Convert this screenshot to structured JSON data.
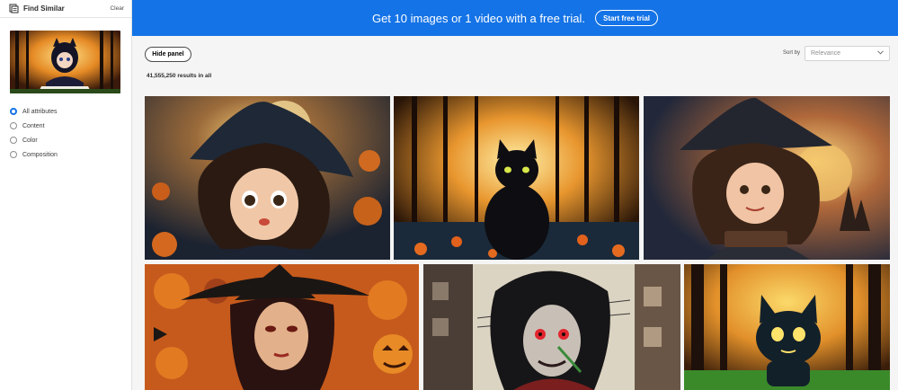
{
  "sidebar": {
    "title": "Find Similar",
    "clear_label": "Clear",
    "options": [
      {
        "label": "All attributes",
        "selected": true
      },
      {
        "label": "Content",
        "selected": false
      },
      {
        "label": "Color",
        "selected": false
      },
      {
        "label": "Composition",
        "selected": false
      }
    ]
  },
  "banner": {
    "text": "Get 10 images or 1 video with a free trial.",
    "cta_label": "Start free trial"
  },
  "toolbar": {
    "hide_panel_label": "Hide panel",
    "results_text": "41,555,250 results in all",
    "sort_label": "Sort by",
    "sort_value": "Relevance"
  },
  "colors": {
    "accent": "#1473e6",
    "sidebar_bg": "#ffffff",
    "page_bg": "#f5f5f5"
  },
  "icons": {
    "find_similar": "find-similar-icon",
    "sort_dropdown": "chevron-down-icon"
  },
  "results": [
    {
      "subject": "witch-girl-pumpkins"
    },
    {
      "subject": "black-cat-forest"
    },
    {
      "subject": "witch-girl-castle"
    },
    {
      "subject": "witch-jack-o-lanterns"
    },
    {
      "subject": "dark-anime-vampire"
    },
    {
      "subject": "cat-creature-forest"
    }
  ]
}
